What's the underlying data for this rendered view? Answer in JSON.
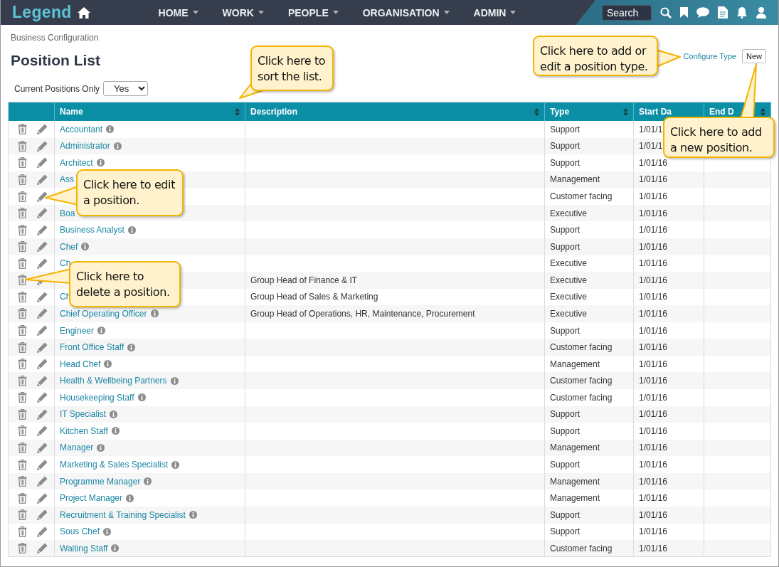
{
  "nav": {
    "logo": "Legend",
    "items": [
      {
        "label": "HOME"
      },
      {
        "label": "WORK"
      },
      {
        "label": "PEOPLE"
      },
      {
        "label": "ORGANISATION"
      },
      {
        "label": "ADMIN"
      }
    ],
    "search": {
      "placeholder": "Search"
    }
  },
  "breadcrumb": "Business Configuration",
  "title": "Position List",
  "actions": {
    "configure": "Configure Type",
    "new": "New"
  },
  "filter": {
    "label": "Current Positions Only",
    "value": "Yes"
  },
  "table": {
    "columns": [
      {
        "label": "Name",
        "sort_icon": true
      },
      {
        "label": "Description",
        "sort_icon": true
      },
      {
        "label": "Type",
        "sort_icon": true
      },
      {
        "label": "Start Da",
        "sort_icon": false
      },
      {
        "label": "End D",
        "sort_icon": true
      }
    ],
    "rows": [
      {
        "name": "Accountant",
        "info": true,
        "type": "Support",
        "start": "1/01/1"
      },
      {
        "name": "Administrator",
        "info": true,
        "type": "Support",
        "start": "1/01/1"
      },
      {
        "name": "Architect",
        "info": true,
        "type": "Support",
        "start": "1/01/16"
      },
      {
        "name": "Ass",
        "info": false,
        "type": "Management",
        "start": "1/01/16"
      },
      {
        "info": false,
        "type": "Customer facing",
        "start": "1/01/16"
      },
      {
        "name": "Boa",
        "info": false,
        "type": "Executive",
        "start": "1/01/16"
      },
      {
        "name": "Business Analyst",
        "info": true,
        "type": "Support",
        "start": "1/01/16"
      },
      {
        "name": "Chef",
        "info": true,
        "type": "Support",
        "start": "1/01/16"
      },
      {
        "name": "Ch",
        "info": false,
        "type": "Executive",
        "start": "1/01/16"
      },
      {
        "info": false,
        "description": "Group Head of Finance & IT",
        "type": "Executive",
        "start": "1/01/16"
      },
      {
        "name": "Ch",
        "info": false,
        "description": "Group Head of Sales & Marketing",
        "type": "Executive",
        "start": "1/01/16"
      },
      {
        "name": "Chief Operating Officer",
        "info": true,
        "description": "Group Head of Operations, HR, Maintenance, Procurement",
        "type": "Executive",
        "start": "1/01/16"
      },
      {
        "name": "Engineer",
        "info": true,
        "type": "Support",
        "start": "1/01/16"
      },
      {
        "name": "Front Office Staff",
        "info": true,
        "type": "Customer facing",
        "start": "1/01/16"
      },
      {
        "name": "Head Chef",
        "info": true,
        "type": "Management",
        "start": "1/01/16"
      },
      {
        "name": "Health & Wellbeing Partners",
        "info": true,
        "type": "Customer facing",
        "start": "1/01/16"
      },
      {
        "name": "Housekeeping Staff",
        "info": true,
        "type": "Customer facing",
        "start": "1/01/16"
      },
      {
        "name": "IT Specialist",
        "info": true,
        "type": "Support",
        "start": "1/01/16"
      },
      {
        "name": "Kitchen Staff",
        "info": true,
        "type": "Support",
        "start": "1/01/16"
      },
      {
        "name": "Manager",
        "info": true,
        "type": "Management",
        "start": "1/01/16"
      },
      {
        "name": "Marketing & Sales Specialist",
        "info": true,
        "type": "Support",
        "start": "1/01/16"
      },
      {
        "name": "Programme Manager",
        "info": true,
        "type": "Management",
        "start": "1/01/16"
      },
      {
        "name": "Project Manager",
        "info": true,
        "type": "Management",
        "start": "1/01/16"
      },
      {
        "name": "Recruitment & Training Specialist",
        "info": true,
        "type": "Support",
        "start": "1/01/16"
      },
      {
        "name": "Sous Chef",
        "info": true,
        "type": "Support",
        "start": "1/01/16"
      },
      {
        "name": "Waiting Staff",
        "info": true,
        "type": "Customer facing",
        "start": "1/01/16"
      }
    ]
  },
  "callouts": [
    {
      "text": "Click here to sort the list."
    },
    {
      "text": "Click here to add or edit a position type."
    },
    {
      "text": "Click here to add a new position."
    },
    {
      "text": "Click here to edit a position."
    },
    {
      "text": "Click here to delete a position."
    }
  ]
}
